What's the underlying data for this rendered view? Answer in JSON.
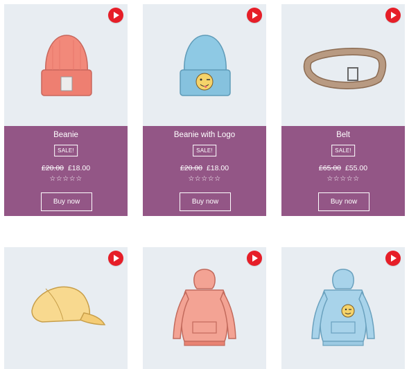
{
  "products": [
    {
      "title": "Beanie",
      "sale": "SALE!",
      "old_price": "£20.00",
      "price": "£18.00",
      "rating_stars": "☆☆☆☆☆",
      "button": "Buy now",
      "icon": "beanie-image",
      "colors": {
        "main": "#f2897a"
      }
    },
    {
      "title": "Beanie with Logo",
      "sale": "SALE!",
      "old_price": "£20.00",
      "price": "£18.00",
      "rating_stars": "☆☆☆☆☆",
      "button": "Buy now",
      "icon": "beanie-with-logo-image",
      "colors": {
        "main": "#8ec9e4"
      }
    },
    {
      "title": "Belt",
      "sale": "SALE!",
      "old_price": "£65.00",
      "price": "£55.00",
      "rating_stars": "☆☆☆☆☆",
      "button": "Buy now",
      "icon": "belt-image",
      "colors": {
        "main": "#b89a82"
      }
    },
    {
      "icon": "cap-image",
      "colors": {
        "main": "#f8d98f"
      }
    },
    {
      "icon": "hoodie-image",
      "colors": {
        "main": "#f3a394"
      }
    },
    {
      "icon": "hoodie-with-logo-image",
      "colors": {
        "main": "#a8d3ea"
      }
    }
  ],
  "colors": {
    "info_bg": "#935686",
    "card_bg": "#e8edf2",
    "play": "#e61e28"
  }
}
